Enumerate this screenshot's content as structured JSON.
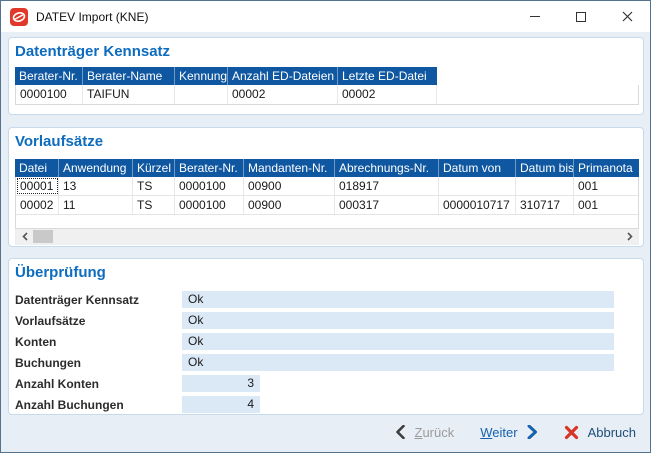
{
  "window": {
    "title": "DATEV Import (KNE)"
  },
  "kennsatz": {
    "title": "Datenträger Kennsatz",
    "columns": [
      "Berater-Nr.",
      "Berater-Name",
      "Kennung",
      "Anzahl ED-Dateien",
      "Letzte ED-Datei"
    ],
    "rows": [
      [
        "0000100",
        "TAIFUN",
        "",
        "00002",
        "00002"
      ]
    ]
  },
  "vorlauf": {
    "title": "Vorlaufsätze",
    "columns": [
      "Datei",
      "Anwendung",
      "Kürzel",
      "Berater-Nr.",
      "Mandanten-Nr.",
      "Abrechnungs-Nr.",
      "Datum von",
      "Datum bis",
      "Primanota"
    ],
    "rows": [
      [
        "00001",
        "13",
        "TS",
        "0000100",
        "00900",
        "018917",
        "",
        "",
        "001"
      ],
      [
        "00002",
        "11",
        "TS",
        "0000100",
        "00900",
        "000317",
        "0000010717",
        "310717",
        "001"
      ]
    ]
  },
  "pruefung": {
    "title": "Überprüfung",
    "rows": [
      {
        "label": "Datenträger Kennsatz",
        "value": "Ok"
      },
      {
        "label": "Vorlaufsätze",
        "value": "Ok"
      },
      {
        "label": "Konten",
        "value": "Ok"
      },
      {
        "label": "Buchungen",
        "value": "Ok"
      },
      {
        "label": "Anzahl Konten",
        "value": "3"
      },
      {
        "label": "Anzahl Buchungen",
        "value": "4"
      }
    ]
  },
  "footer": {
    "back": "Zurück",
    "next": "Weiter",
    "cancel": "Abbruch"
  },
  "colors": {
    "heading_blue": "#0d6cbe",
    "table_header_bg": "#0f57a0",
    "field_bg": "#dbe8f6",
    "window_border": "#54738f",
    "next_blue": "#1563ae",
    "cancel_navy": "#1d4e79",
    "abort_red": "#d93526",
    "disabled_gray": "#9b9b9b"
  }
}
